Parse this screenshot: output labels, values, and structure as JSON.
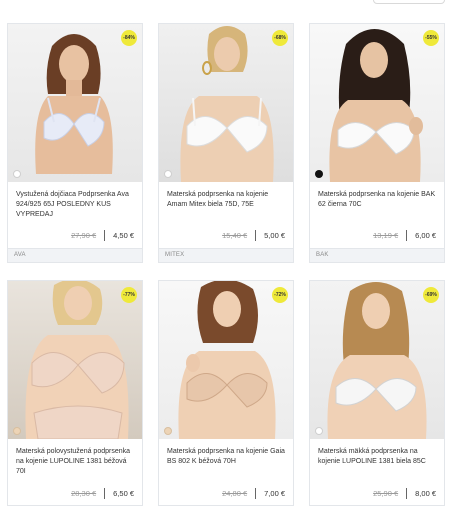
{
  "colors": {
    "badge": "#efe93a",
    "border": "#e3e6ea",
    "footer_bg": "#f1f3f6"
  },
  "products": [
    {
      "name": "Vystužená dojčiaca Podprsenka Ava 924/925 65J POSLEDNY KUS VYPREDAJ",
      "old_price": "27,90 €",
      "price": "4,50 €",
      "discount": "-84%",
      "brand": "AVA",
      "swatch": "white"
    },
    {
      "name": "Materská podprsenka na kojenie Amam Mitex biela 75D, 75E",
      "old_price": "15,40 €",
      "price": "5,00 €",
      "discount": "-68%",
      "brand": "MITEX",
      "swatch": "white"
    },
    {
      "name": "Materská podprsenka na kojenie BAK 62 čierna 70C",
      "old_price": "13,19 €",
      "price": "6,00 €",
      "discount": "-55%",
      "brand": "BAK",
      "swatch": "black"
    },
    {
      "name": "Materská polovystužená podprsenka na kojenie LUPOLINE 1381 béžová 70I",
      "old_price": "28,30 €",
      "price": "6,50 €",
      "discount": "-77%",
      "swatch": "nude"
    },
    {
      "name": "Materská podprsenka na kojenie Gaia BS 802 K béžová 70H",
      "old_price": "24,80 €",
      "price": "7,00 €",
      "discount": "-72%",
      "swatch": "nude"
    },
    {
      "name": "Materská mäkká podprsenka na kojenie LUPOLINE 1381 biela 85C",
      "old_price": "25,90 €",
      "price": "8,00 €",
      "discount": "-69%",
      "swatch": "white"
    }
  ]
}
